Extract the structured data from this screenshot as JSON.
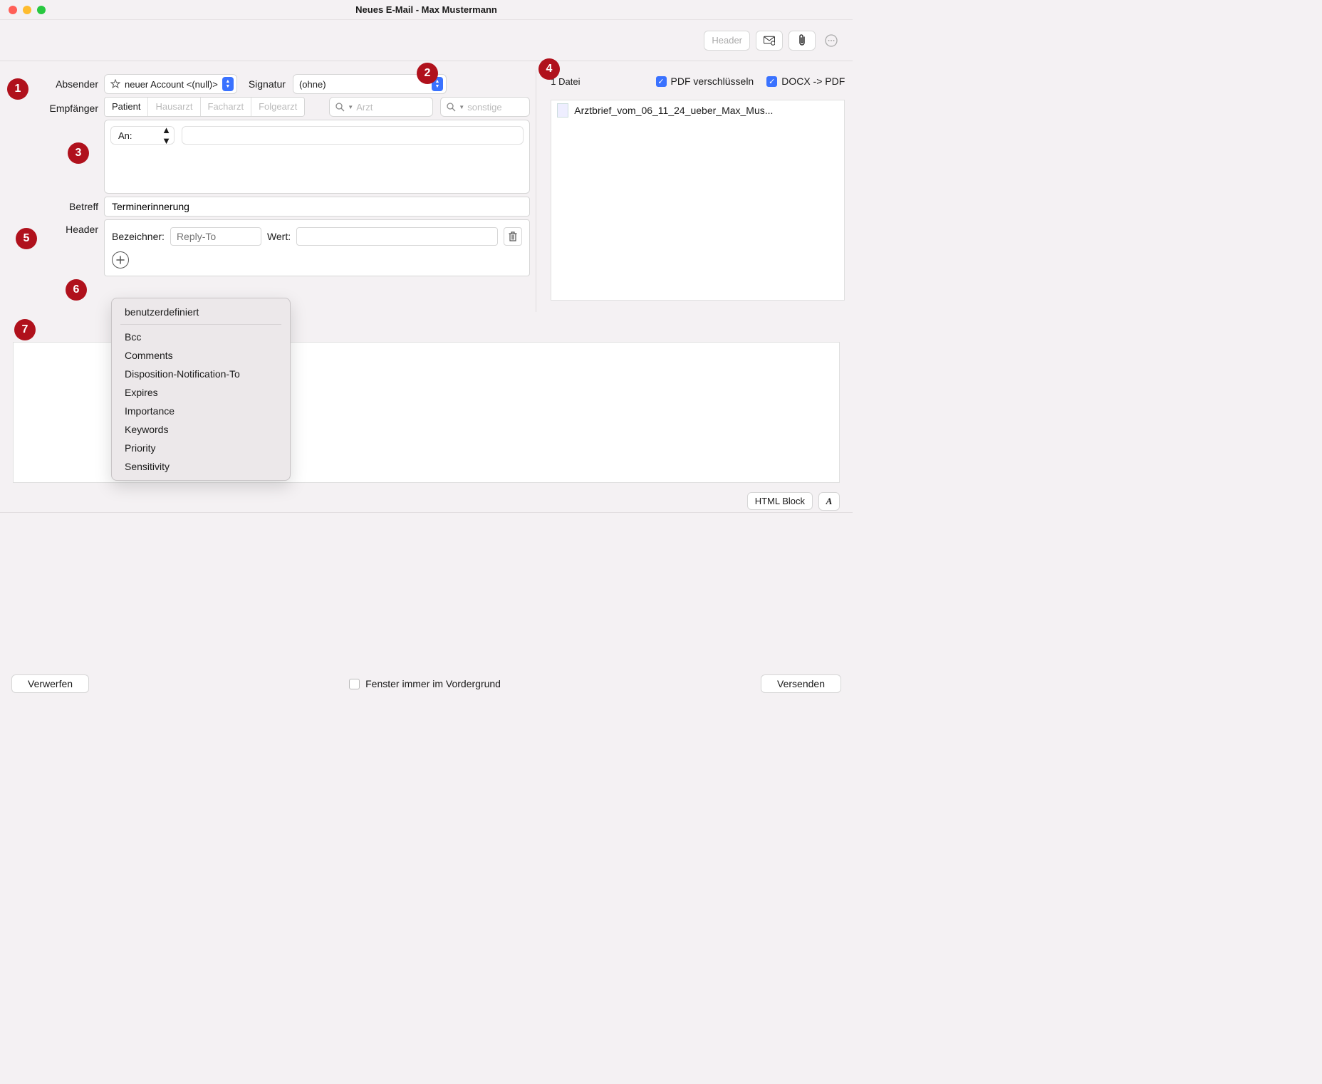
{
  "window": {
    "title": "Neues E-Mail - Max Mustermann"
  },
  "toolbar": {
    "header_btn": "Header"
  },
  "labels": {
    "absender": "Absender",
    "signatur": "Signatur",
    "empfaenger": "Empfänger",
    "betreff": "Betreff",
    "header": "Header",
    "bezeichner": "Bezeichner:",
    "wert": "Wert:"
  },
  "sender": {
    "value": "neuer Account <(null)>"
  },
  "signatur": {
    "value": "(ohne)"
  },
  "recipient_tabs": [
    "Patient",
    "Hausarzt",
    "Facharzt",
    "Folgearzt"
  ],
  "search": {
    "arzt_placeholder": "Arzt",
    "sonstige_placeholder": "sonstige"
  },
  "to": {
    "label": "An:"
  },
  "subject": {
    "value": "Terminerinnerung"
  },
  "header_block": {
    "bezeichner_placeholder": "Reply-To"
  },
  "attachments": {
    "count_label": "1 Datei",
    "pdf_encrypt": "PDF verschlüsseln",
    "docx_to_pdf": "DOCX -> PDF",
    "file": "Arztbrief_vom_06_11_24_ueber_Max_Mus..."
  },
  "popup": [
    "benutzerdefiniert",
    "Bcc",
    "Comments",
    "Disposition-Notification-To",
    "Expires",
    "Importance",
    "Keywords",
    "Priority",
    "Sensitivity"
  ],
  "body_toolbar": {
    "html_block": "HTML Block"
  },
  "footer": {
    "verwerfen": "Verwerfen",
    "always_top": "Fenster immer im Vordergrund",
    "versenden": "Versenden"
  },
  "annotations": [
    "1",
    "2",
    "3",
    "4",
    "5",
    "6",
    "7"
  ]
}
